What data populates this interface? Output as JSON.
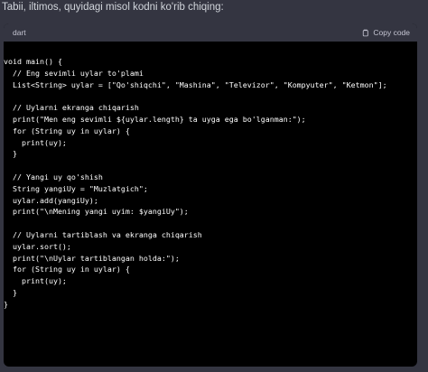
{
  "message": {
    "intro": "Tabii, iltimos, quyidagi misol kodni ko'rib chiqing:"
  },
  "code_block": {
    "language": "dart",
    "copy_label": "Copy code",
    "copy_icon": "clipboard-icon",
    "lines": [
      "void main() {",
      "  // Eng sevimli uylar to'plami",
      "  List<String> uylar = [\"Qo'shiqchi\", \"Mashina\", \"Televizor\", \"Kompyuter\", \"Ketmon\"];",
      "",
      "  // Uylarni ekranga chiqarish",
      "  print(\"Men eng sevimli ${uylar.length} ta uyga ega bo'lganman:\");",
      "  for (String uy in uylar) {",
      "    print(uy);",
      "  }",
      "",
      "  // Yangi uy qo'shish",
      "  String yangiUy = \"Muzlatgich\";",
      "  uylar.add(yangiUy);",
      "  print(\"\\nMening yangi uyim: $yangiUy\");",
      "",
      "  // Uylarni tartiblash va ekranga chiqarish",
      "  uylar.sort();",
      "  print(\"\\nUylar tartiblangan holda:\");",
      "  for (String uy in uylar) {",
      "    print(uy);",
      "  }",
      "}"
    ]
  }
}
